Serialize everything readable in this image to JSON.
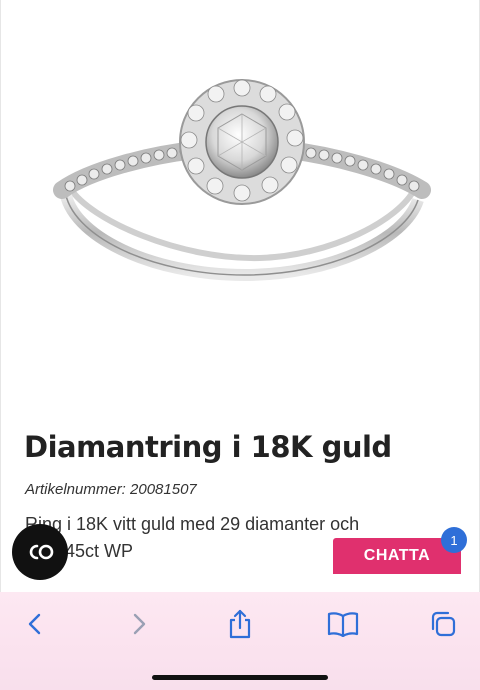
{
  "product": {
    "title": "Diamantring i 18K guld",
    "article_label": "Artikelnummer:",
    "article_number": "20081507",
    "description": "Ring i 18K vitt guld med 29 diamanter och\ntot 0,45ct WP"
  },
  "overlay": {
    "co_icon": "co-logo-icon",
    "chat_label": "CHATTA",
    "chat_badge": "1",
    "chat_color": "#e0306e",
    "badge_color": "#2f6fd8"
  },
  "browser_toolbar": {
    "icons": [
      "back-icon",
      "forward-icon",
      "share-icon",
      "bookmarks-icon",
      "tabs-icon"
    ],
    "tint": "#fbe3ef",
    "icon_color": "#2f6fd8"
  }
}
